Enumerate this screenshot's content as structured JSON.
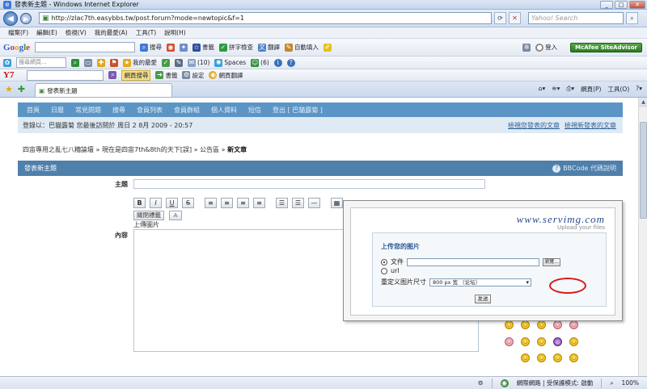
{
  "window": {
    "title": "發表新主題 - Windows Internet Explorer",
    "url": "http://zlac7th.easybbs.tw/post.forum?mode=newtopic&f=1",
    "search_placeholder": "Yahoo! Search",
    "minimize": "_",
    "maximize": "□",
    "close": "✕"
  },
  "menu": [
    "檔案(F)",
    "編輯(E)",
    "檢視(V)",
    "我的最愛(A)",
    "工具(T)",
    "說明(H)"
  ],
  "toolbar_google": {
    "logo": "Google",
    "search_label": "搜尋",
    "bookmarks_label": "書籤",
    "spellcheck_label": "拼字檢查",
    "translate_label": "翻譯",
    "autofill_label": "自動填入",
    "login_label": "登入",
    "mcafee_label": "McAfee SiteAdvisor"
  },
  "toolbar_msn": {
    "search_placeholder": "搜尋網頁...",
    "favorites_label": "我的最愛",
    "mail_count": "(10)",
    "spaces_label": "Spaces",
    "messenger_count": "(6)"
  },
  "toolbar_yahoo": {
    "logo": "Y7",
    "search_label": "網頁搜尋",
    "bookmarks_label": "書籤",
    "settings_label": "設定",
    "translate_label": "網頁翻譯"
  },
  "tab": {
    "label": "發表新主題"
  },
  "tab_tools": [
    "網頁(P)",
    "工具(O)"
  ],
  "forum": {
    "nav": [
      "首頁",
      "日曆",
      "常見問題",
      "搜尋",
      "會員列表",
      "會員群組",
      "個人資料",
      "短信",
      "登出 [ 巴貓露菊 ]"
    ],
    "login_text": "登錄以：巴貓露菊 您最後訪問於 周日 2 8月 2009 - 20:57",
    "login_links": [
      "檢視您發表的文章",
      "檢視新發表的文章"
    ],
    "breadcrumb": [
      "四宙專用之亂七八糟論壇",
      "現在是四宙7th&8th的天下[誤]",
      "公告區",
      "新文章"
    ],
    "breadcrumb_sep": "»",
    "panel_title": "發表新主題",
    "bbcode_label": "BBCode 代碼說明",
    "subject_label": "主題",
    "content_label": "內容",
    "editor_buttons": [
      "B",
      "I",
      "U",
      "S"
    ],
    "source_button": "關閉標籤",
    "font_button": "A",
    "upload_text": "上傳圖片"
  },
  "popup": {
    "logo": "www.servimg.com",
    "tagline": "Upload your files",
    "title": "上传您的图片",
    "file_label": "文件",
    "browse_label": "瀏覽...",
    "url_label": "url",
    "resize_label": "重定义图片尺寸",
    "size_option": "800 px 宽 （论坛）",
    "send_label": "发送"
  },
  "statusbar": {
    "zone": "網際網路 | 受保護模式: 啟動",
    "zoom": "100%"
  },
  "colors": {
    "forum_nav": "#5b95c5",
    "panel_head": "#4f7fab",
    "highlight_circle": "#d81a1a"
  }
}
